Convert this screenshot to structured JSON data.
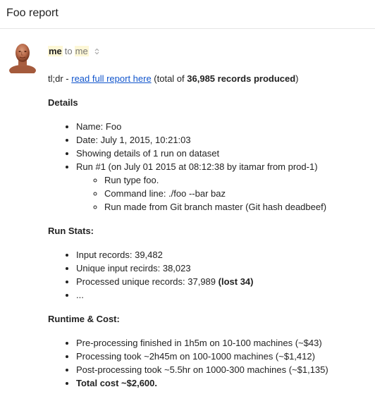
{
  "subject": "Foo report",
  "header": {
    "sender": "me",
    "to_word": "to",
    "recipient": "me"
  },
  "tldr": {
    "prefix": "tl;dr - ",
    "link_text": "read full report here",
    "mid_text": " (total of ",
    "records": "36,985 records produced",
    "suffix": ")"
  },
  "details": {
    "heading": "Details",
    "items": [
      "Name: Foo",
      "Date: July 1, 2015, 10:21:03",
      "Showing details of 1 run on dataset",
      "Run #1 (on July 01 2015 at 08:12:38 by itamar from prod-1)"
    ],
    "sub_items": [
      "Run type foo.",
      "Command line: ./foo --bar baz",
      "Run made from Git branch master (Git hash deadbeef)"
    ]
  },
  "run_stats": {
    "heading": "Run Stats:",
    "items": [
      "Input records: 39,482",
      "Unique input recirds: 38,023",
      "Processed unique records: 37,989 "
    ],
    "lost": "(lost 34)",
    "ellipsis": "..."
  },
  "runtime": {
    "heading": "Runtime & Cost:",
    "items": [
      "Pre-processing finished in 1h5m on 10-100 machines (~$43)",
      "Processing took ~2h45m on 100-1000 machines (~$1,412)",
      "Post-processing took ~5.5hr on 1000-300 machines (~$1,135)"
    ],
    "total": "Total cost ~$2,600."
  },
  "icons": {
    "avatar": "avatar-photo",
    "dropdown": "chevron-updown-icon"
  }
}
